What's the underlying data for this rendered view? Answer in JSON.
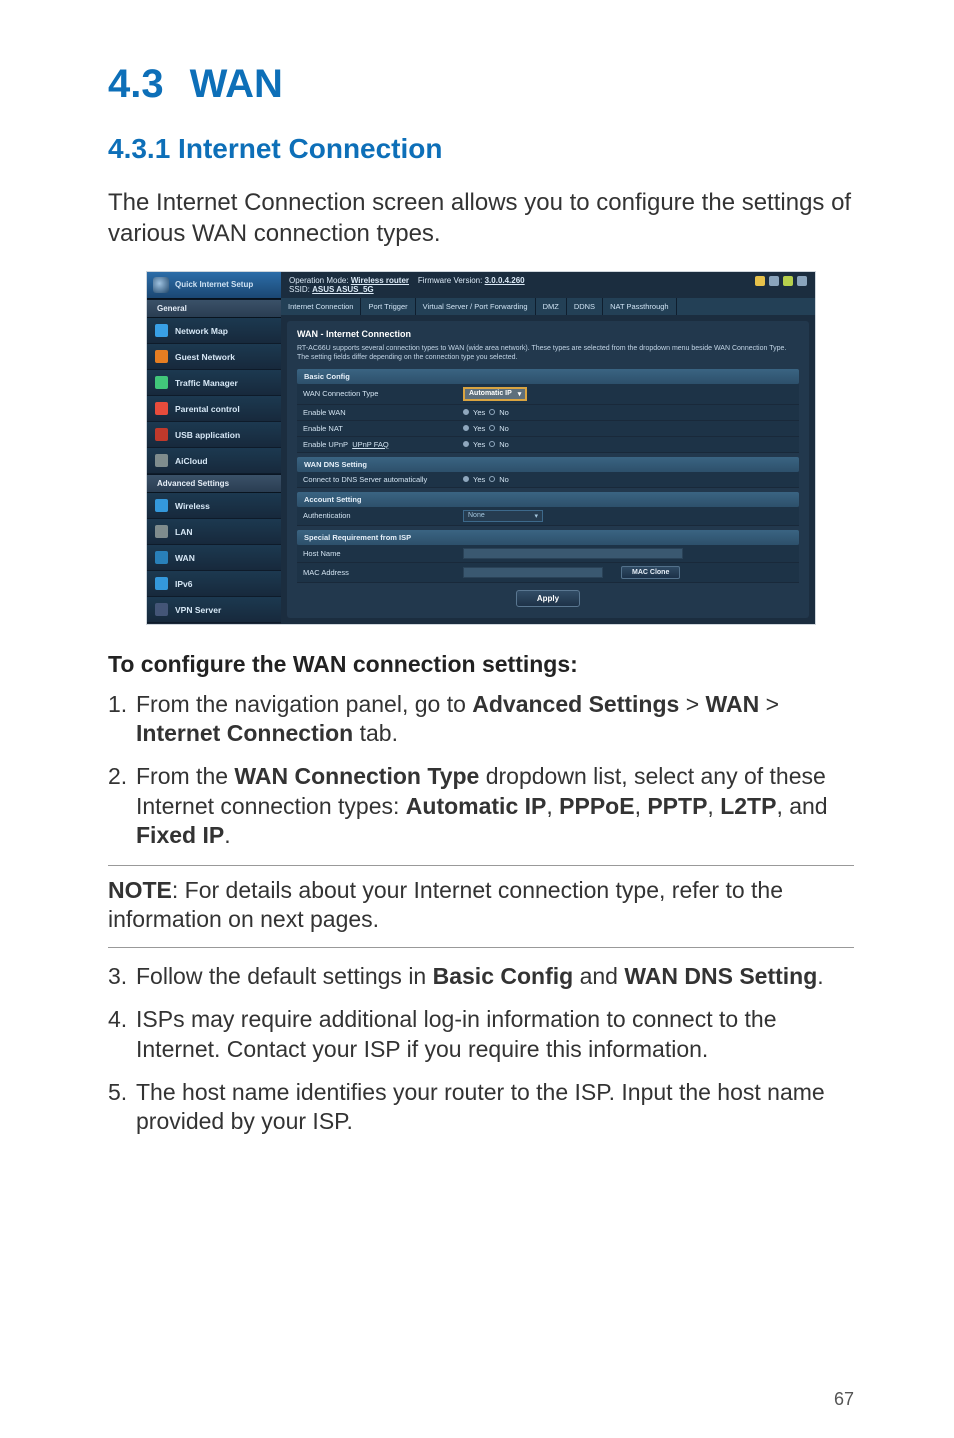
{
  "section": {
    "number": "4.3",
    "title": "WAN"
  },
  "subsection": "4.3.1 Internet Connection",
  "intro": "The Internet Connection screen allows you to configure the settings of various WAN connection types.",
  "screenshot": {
    "qis": "Quick Internet Setup",
    "side_general": "General",
    "side_advanced": "Advanced Settings",
    "items": {
      "map": "Network Map",
      "guest": "Guest Network",
      "traffic": "Traffic Manager",
      "parental": "Parental control",
      "usb": "USB application",
      "aicloud": "AiCloud",
      "wireless": "Wireless",
      "lan": "LAN",
      "wan": "WAN",
      "ipv6": "IPv6",
      "vpn": "VPN Server"
    },
    "top": {
      "opmode_label": "Operation Mode:",
      "opmode_value": "Wireless router",
      "fw_label": "Firmware Version:",
      "fw_value": "3.0.0.4.260",
      "ssid_label": "SSID:",
      "ssid_value": "ASUS ASUS_5G"
    },
    "tabs": {
      "ic": "Internet Connection",
      "pt": "Port Trigger",
      "vs": "Virtual Server / Port Forwarding",
      "dmz": "DMZ",
      "ddns": "DDNS",
      "nat": "NAT Passthrough"
    },
    "panel": {
      "title": "WAN - Internet Connection",
      "desc": "RT-AC66U supports several connection types to WAN (wide area network). These types are selected from the dropdown menu beside WAN Connection Type. The setting fields differ depending on the connection type you selected.",
      "sec_basic": "Basic Config",
      "wan_type_label": "WAN Connection Type",
      "wan_type_value": "Automatic IP",
      "enable_wan": "Enable WAN",
      "enable_nat": "Enable NAT",
      "enable_upnp": "Enable UPnP",
      "upnp_faq": "UPnP FAQ",
      "yes": "Yes",
      "no": "No",
      "sec_dns": "WAN DNS Setting",
      "dns_auto": "Connect to DNS Server automatically",
      "sec_account": "Account Setting",
      "auth_label": "Authentication",
      "auth_value": "None",
      "sec_isp": "Special Requirement from ISP",
      "host_name": "Host Name",
      "mac_addr": "MAC Address",
      "mac_clone": "MAC Clone",
      "apply": "Apply"
    }
  },
  "steps_title": "To configure the WAN connection settings:",
  "steps": {
    "s1_a": "From the navigation panel, go to ",
    "s1_b1": "Advanced Settings",
    "s1_gt1": " > ",
    "s1_b2": "WAN",
    "s1_gt2": " > ",
    "s1_b3": "Internet Connection",
    "s1_c": " tab.",
    "s2_a": "From the ",
    "s2_b1": "WAN Connection Type",
    "s2_b": " dropdown list, select any of these Internet connection types: ",
    "s2_b2": "Automatic IP",
    "s2_c1": ", ",
    "s2_b3": "PPPoE",
    "s2_c2": ", ",
    "s2_b4": "PPTP",
    "s2_c3": ", ",
    "s2_b5": "L2TP",
    "s2_c4": ", and ",
    "s2_b6": "Fixed IP",
    "s2_c5": ".",
    "s3_a": "Follow the default settings in ",
    "s3_b1": "Basic Config",
    "s3_b": " and ",
    "s3_b2": "WAN DNS Setting",
    "s3_c": ".",
    "s4": "ISPs may require additional log-in information to connect to the Internet. Contact your ISP if you require this information.",
    "s5": "The host name identifies your router to the ISP. Input the host name provided by your ISP."
  },
  "note": {
    "label": "NOTE",
    "text": ":  For details about your Internet connection type, refer to the information on next pages."
  },
  "pagenum": "67"
}
